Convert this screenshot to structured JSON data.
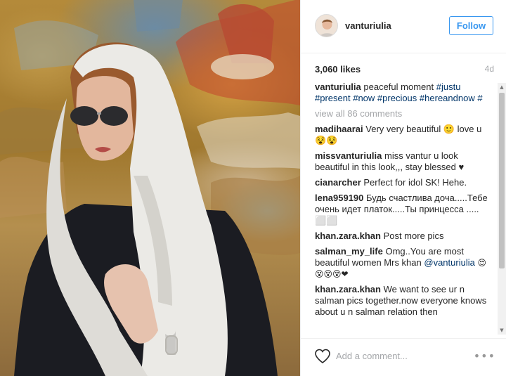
{
  "post": {
    "image_alt": "woman in white scarf and aviator sunglasses"
  },
  "header": {
    "username": "vanturiulia",
    "follow_label": "Follow"
  },
  "stats": {
    "likes": "3,060 likes",
    "age": "4d"
  },
  "caption": {
    "user": "vanturiulia",
    "text": "peaceful moment",
    "tags": [
      "#justu",
      "#present",
      "#now",
      "#precious",
      "#hereandnow",
      "#"
    ]
  },
  "view_all": "view all 86 comments",
  "comments": [
    {
      "user": "madihaarai",
      "text": "Very very beautiful 🙂 love u 😵😵"
    },
    {
      "user": "missvanturiulia",
      "text": "miss vantur u look beautiful in this look,,, stay blessed ♥"
    },
    {
      "user": "cianarcher",
      "text": "Perfect for idol SK! Hehe."
    },
    {
      "user": "lena959190",
      "text": "Будь счастлива доча.....Тебе очень идет платок.....Ты принцесса ..... ⬜⬜"
    },
    {
      "user": "khan.zara.khan",
      "text": "Post more pics"
    },
    {
      "user": "salman_my_life",
      "text": "Omg..You are most beautiful women Mrs khan",
      "mention": "@vanturiulia",
      "tail": "😍😵😵😵❤"
    },
    {
      "user": "khan.zara.khan",
      "text": "We want to see ur n salman pics together.now everyone knows about u n salman relation then"
    }
  ],
  "footer": {
    "add_comment_placeholder": "Add a comment...",
    "more_label": "•••"
  },
  "scrollbar": {
    "up_arrow": "▲",
    "down_arrow": "▼"
  },
  "colors": {
    "follow_blue": "#3897f0",
    "hashtag": "#003569",
    "muted": "#a5a7aa"
  }
}
